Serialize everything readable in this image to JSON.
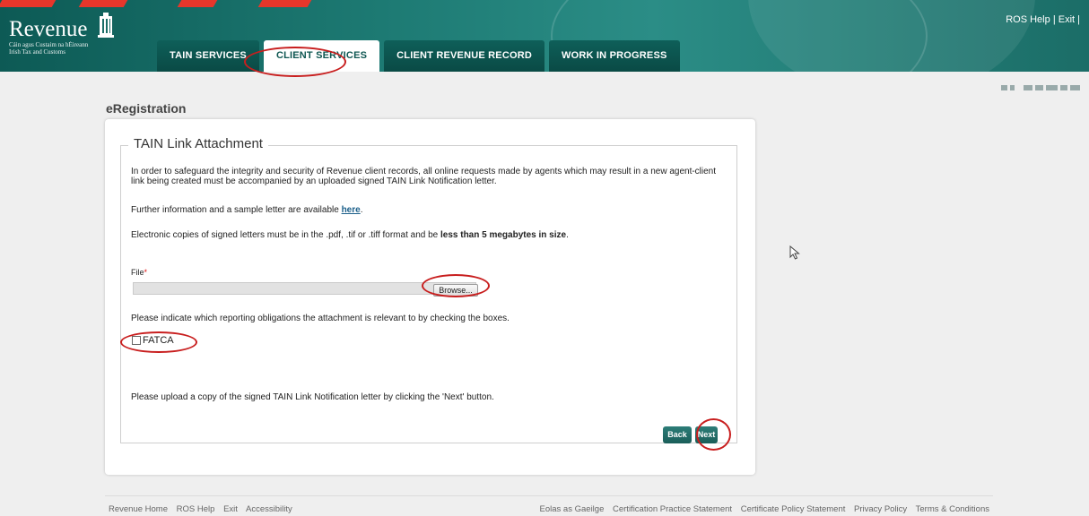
{
  "header": {
    "logo_main": "Revenue",
    "logo_sub1": "Cáin agus Custaim na hÉireann",
    "logo_sub2": "Irish Tax and Customs",
    "tabs": [
      {
        "label": "TAIN SERVICES"
      },
      {
        "label": "CLIENT SERVICES"
      },
      {
        "label": "CLIENT REVENUE RECORD"
      },
      {
        "label": "WORK IN PROGRESS"
      }
    ],
    "active_tab": "CLIENT SERVICES",
    "help_link": "ROS Help",
    "separator": "|",
    "exit_link": "Exit",
    "trailing_sep": "|"
  },
  "page": {
    "title": "eRegistration"
  },
  "form": {
    "legend": "TAIN Link Attachment",
    "intro_line1": "In order to safeguard the integrity and security of Revenue client records, all online requests made by agents which may result in a new agent-client",
    "intro_line2": "link being created must be accompanied by an uploaded signed TAIN Link Notification letter.",
    "further_info_prefix": "Further information and a sample letter are available ",
    "further_info_link": "here",
    "further_info_suffix": ".",
    "electronic_prefix": "Electronic copies of signed letters must be in the .pdf, .tif or .tiff format and be ",
    "electronic_bold": "less than 5 megabytes in size",
    "electronic_suffix": ".",
    "file_label": "File",
    "required_mark": "*",
    "browse_label": "Browse...",
    "obligations_text": "Please indicate which reporting obligations the attachment is relevant to by checking the boxes.",
    "checkbox_label": "FATCA",
    "checkbox_checked": false,
    "upload_text": "Please upload a copy of the signed TAIN Link Notification letter by clicking the 'Next' button.",
    "back_label": "Back",
    "next_label": "Next"
  },
  "footer": {
    "left_links": [
      "Revenue Home",
      "ROS Help",
      "Exit",
      "Accessibility"
    ],
    "right_links": [
      "Eolas as Gaeilge",
      "Certification Practice Statement",
      "Certificate Policy Statement",
      "Privacy Policy",
      "Terms & Conditions"
    ]
  },
  "colors": {
    "header_teal": "#1d7a73",
    "tab_dark": "#0e5f59",
    "button_teal": "#1a5e59",
    "annotation_red": "#c81e1e"
  },
  "icons": [
    "harp-icon",
    "cursor-icon"
  ]
}
